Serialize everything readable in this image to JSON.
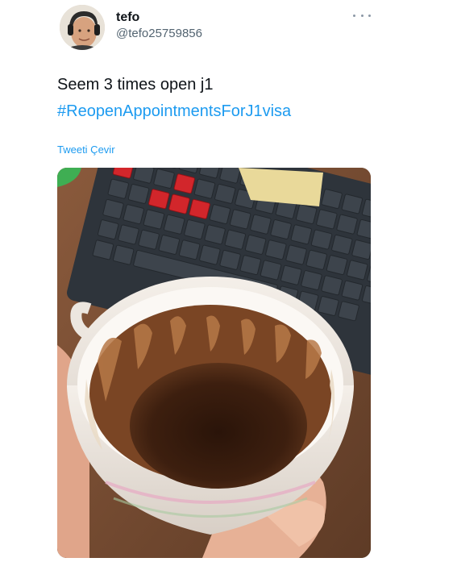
{
  "user": {
    "display_name": "tefo",
    "handle": "@tefo25759856",
    "avatar_icon": "user-avatar-photo"
  },
  "tweet": {
    "text": "Seem 3 times open j1",
    "hashtag": "#ReopenAppointmentsForJ1visa",
    "translate_label": "Tweeti Çevir"
  },
  "menu": {
    "more_icon": "ellipsis-icon"
  },
  "media": {
    "description_icon": "coffee-cup-photo"
  },
  "colors": {
    "link": "#1d9bf0",
    "text": "#0f1419",
    "secondary": "#536471"
  }
}
